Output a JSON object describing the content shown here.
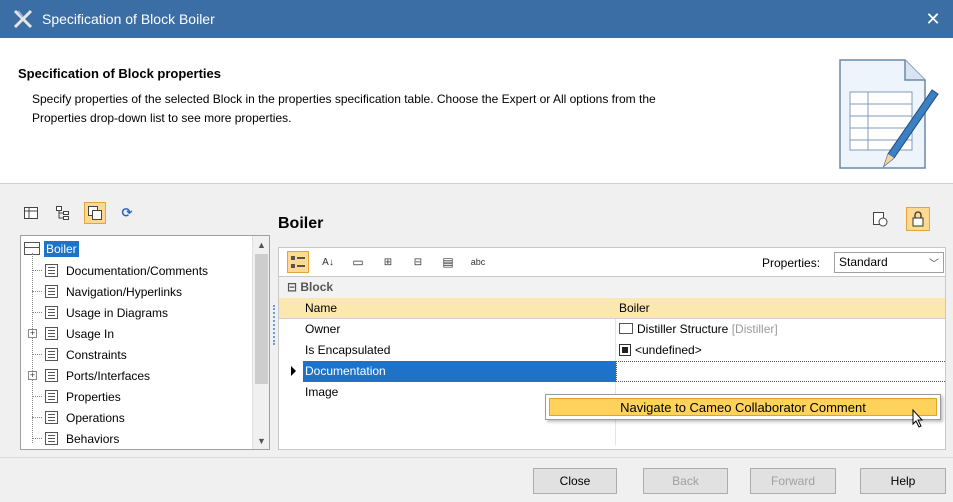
{
  "window": {
    "title": "Specification of Block Boiler",
    "close_glyph": "✕"
  },
  "header": {
    "title": "Specification of Block properties",
    "description_line1": "Specify properties of the selected Block in the properties specification table. Choose the Expert or All options from the",
    "description_line2": "Properties drop-down list to see more properties."
  },
  "left_toolbar": {
    "icons": [
      "table-icon",
      "tree-view-icon",
      "copy-icon",
      "refresh-icon"
    ]
  },
  "tree": {
    "root": "Boiler",
    "items": [
      {
        "label": "Documentation/Comments",
        "expandable": false
      },
      {
        "label": "Navigation/Hyperlinks",
        "expandable": false
      },
      {
        "label": "Usage in Diagrams",
        "expandable": false
      },
      {
        "label": "Usage In",
        "expandable": true
      },
      {
        "label": "Constraints",
        "expandable": false
      },
      {
        "label": "Ports/Interfaces",
        "expandable": true
      },
      {
        "label": "Properties",
        "expandable": false
      },
      {
        "label": "Operations",
        "expandable": false
      },
      {
        "label": "Behaviors",
        "expandable": false
      }
    ]
  },
  "panel": {
    "title": "Boiler",
    "properties_label": "Properties:",
    "properties_value": "Standard"
  },
  "grid": {
    "category": "Block",
    "header": {
      "name": "Name",
      "value": "Boiler"
    },
    "rows": [
      {
        "name": "Owner",
        "value": "Distiller Structure",
        "value_note": "[Distiller]"
      },
      {
        "name": "Is Encapsulated",
        "value": "<undefined>"
      },
      {
        "name": "Documentation",
        "value": ""
      },
      {
        "name": "Image",
        "value": ""
      }
    ]
  },
  "context_menu": {
    "item": "Navigate to Cameo Collaborator Comment"
  },
  "footer": {
    "close": "Close",
    "back": "Back",
    "forward": "Forward",
    "help": "Help"
  },
  "colors": {
    "titlebar": "#3a6ea5",
    "selection": "#1e73c8",
    "highlight": "#ffd25c",
    "header_row": "#fbe7b0"
  }
}
